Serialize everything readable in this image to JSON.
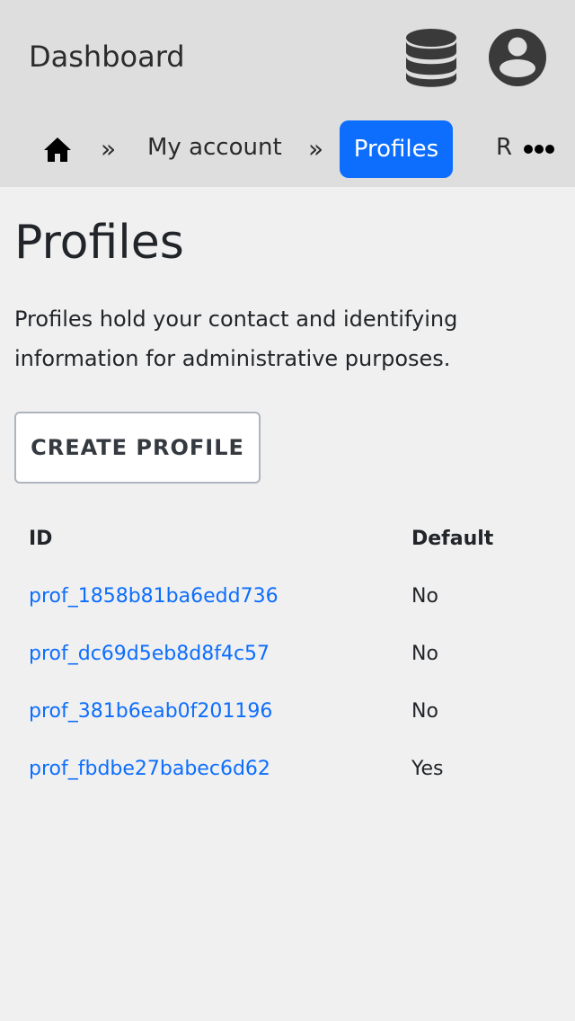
{
  "header": {
    "title": "Dashboard",
    "database_icon": "database-icon",
    "account_icon": "user-circle-icon"
  },
  "breadcrumb": {
    "home_icon": "home-icon",
    "separator": "»",
    "items": [
      {
        "label": "My account",
        "active": false
      },
      {
        "label": "Profiles",
        "active": true
      },
      {
        "label": "R",
        "active": false
      }
    ],
    "more_icon": "more-horizontal-icon"
  },
  "main": {
    "title": "Profiles",
    "description": "Profiles hold your contact and identifying information for administrative purposes.",
    "create_button": "CREATE PROFILE"
  },
  "table": {
    "columns": [
      "ID",
      "Default"
    ],
    "rows": [
      {
        "id": "prof_1858b81ba6edd736",
        "default": "No"
      },
      {
        "id": "prof_dc69d5eb8d8f4c57",
        "default": "No"
      },
      {
        "id": "prof_381b6eab0f201196",
        "default": "No"
      },
      {
        "id": "prof_fbdbe27babec6d62",
        "default": "Yes"
      }
    ]
  },
  "colors": {
    "accent": "#0d6efd",
    "header_bg": "#dedede",
    "page_bg": "#f0f0f0"
  }
}
